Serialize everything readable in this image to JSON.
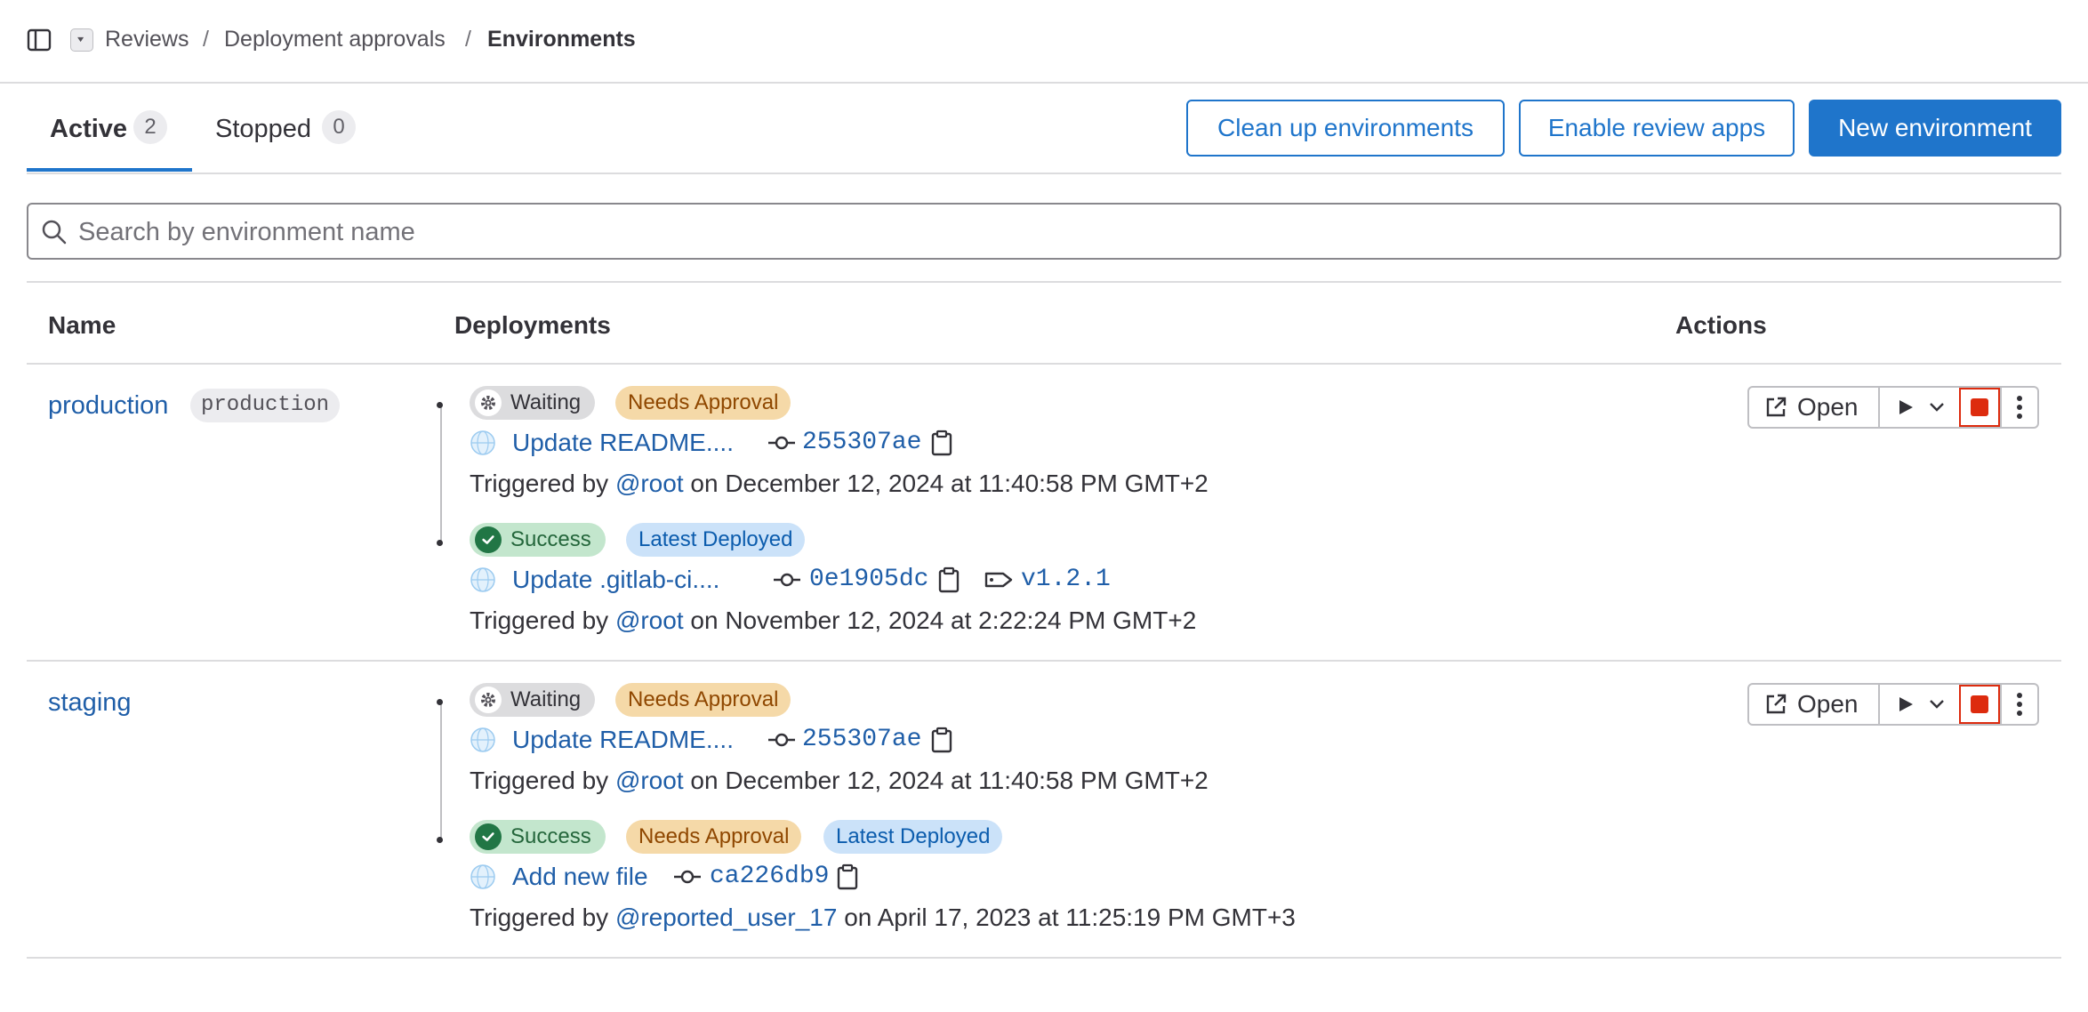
{
  "breadcrumb": {
    "items": [
      "Reviews",
      "Deployment approvals",
      "Environments"
    ],
    "separator": "/"
  },
  "tabs": [
    {
      "label": "Active",
      "count": "2"
    },
    {
      "label": "Stopped",
      "count": "0"
    }
  ],
  "buttons": {
    "cleanup": "Clean up environments",
    "review_apps": "Enable review apps",
    "new_env": "New environment"
  },
  "search": {
    "placeholder": "Search by environment name",
    "value": ""
  },
  "table": {
    "headers": {
      "name": "Name",
      "deployments": "Deployments",
      "actions": "Actions"
    }
  },
  "environments": [
    {
      "name": "production",
      "tier": "production",
      "open_label": "Open",
      "deployments": [
        {
          "status": "Waiting",
          "badges": [
            "Needs Approval"
          ],
          "commit_title": "Update README....",
          "sha": "255307ae",
          "tag": "",
          "triggered_prefix": "Triggered by",
          "user": "@root",
          "date_text": "on December 12, 2024 at 11:40:58 PM GMT+2"
        },
        {
          "status": "Success",
          "badges": [
            "Latest Deployed"
          ],
          "commit_title": "Update .gitlab-ci....",
          "sha": "0e1905dc",
          "tag": "v1.2.1",
          "triggered_prefix": "Triggered by",
          "user": "@root",
          "date_text": "on November 12, 2024 at 2:22:24 PM GMT+2"
        }
      ]
    },
    {
      "name": "staging",
      "tier": "",
      "open_label": "Open",
      "deployments": [
        {
          "status": "Waiting",
          "badges": [
            "Needs Approval"
          ],
          "commit_title": "Update README....",
          "sha": "255307ae",
          "tag": "",
          "triggered_prefix": "Triggered by",
          "user": "@root",
          "date_text": "on December 12, 2024 at 11:40:58 PM GMT+2"
        },
        {
          "status": "Success",
          "badges": [
            "Needs Approval",
            "Latest Deployed"
          ],
          "commit_title": "Add new file",
          "sha": "ca226db9",
          "tag": "",
          "triggered_prefix": "Triggered by",
          "user": "@reported_user_17",
          "date_text": "on April 17, 2023 at 11:25:19 PM GMT+3"
        }
      ]
    }
  ],
  "icons": {
    "sidebar": "sidebar-toggle-icon",
    "search": "search-icon",
    "status_waiting": "gear-icon",
    "status_success": "check-circle-icon",
    "commit": "commit-icon",
    "copy": "clipboard-icon",
    "tag": "tag-icon",
    "avatar": "globe-avatar-icon",
    "open": "external-link-icon",
    "play": "play-icon",
    "chevron": "chevron-down-icon",
    "stop": "stop-icon",
    "more": "kebab-icon"
  },
  "colors": {
    "link": "#1f5ea8",
    "primary": "#1f75cb",
    "stop": "#dd2b0e",
    "success_bg": "#c3e6cd",
    "approval_bg": "#f5d9a8",
    "latest_bg": "#cbe2f9"
  }
}
